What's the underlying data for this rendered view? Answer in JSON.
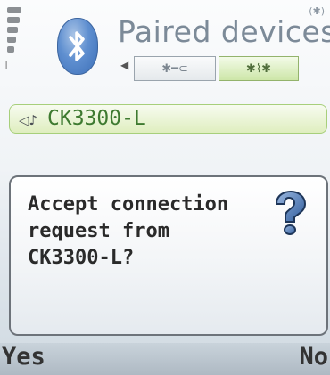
{
  "header": {
    "title": "Paired devices",
    "status_icons": [
      "signal-strength-icon",
      "antenna-icon",
      "bluetooth-small-icon"
    ],
    "app_icon": "bluetooth-badge-icon",
    "tabs": [
      {
        "icon": "bluetooth-headset-icon",
        "active": false
      },
      {
        "icon": "bluetooth-paired-icon",
        "active": true
      }
    ]
  },
  "list": {
    "items": [
      {
        "icon": "audio-device-icon",
        "label": "CK3300-L"
      }
    ]
  },
  "dialog": {
    "message": "Accept connection request from CK3300-L?",
    "icon": "question-icon"
  },
  "softkeys": {
    "left": "Yes",
    "right": "No"
  },
  "colors": {
    "title": "#7c8a98",
    "highlight_border": "#a7cf7b",
    "highlight_text": "#3e7a30",
    "softkey_bar": "#b9c4cd"
  }
}
